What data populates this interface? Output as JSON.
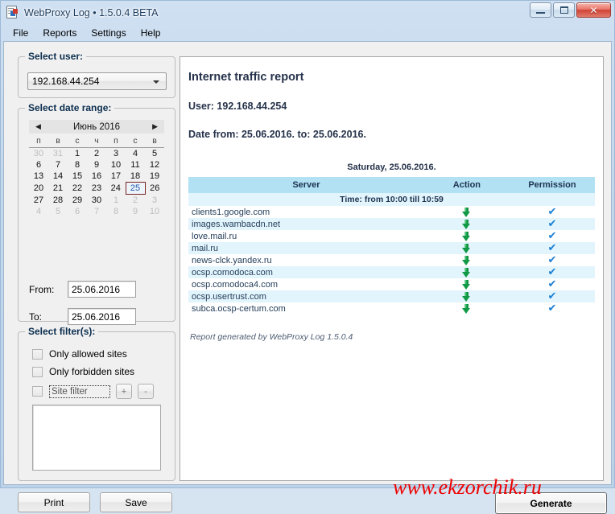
{
  "window": {
    "title": "WebProxy Log • 1.5.0.4 BETA",
    "icon": "report-document-icon",
    "controls": {
      "minimize": "−",
      "maximize": "□",
      "close": "✕"
    }
  },
  "menubar": {
    "items": [
      {
        "label": "File"
      },
      {
        "label": "Reports"
      },
      {
        "label": "Settings"
      },
      {
        "label": "Help"
      }
    ]
  },
  "user_group": {
    "title": "Select user:",
    "selected_user": "192.168.44.254"
  },
  "date_group": {
    "title": "Select date range:",
    "calendar": {
      "prev": "◀",
      "next": "▶",
      "month_title": "Июнь 2016",
      "weekdays": [
        "п",
        "в",
        "с",
        "ч",
        "п",
        "с",
        "в"
      ],
      "weeks": [
        [
          {
            "d": "30",
            "dim": true
          },
          {
            "d": "31",
            "dim": true
          },
          {
            "d": "1"
          },
          {
            "d": "2"
          },
          {
            "d": "3"
          },
          {
            "d": "4"
          },
          {
            "d": "5"
          }
        ],
        [
          {
            "d": "6"
          },
          {
            "d": "7"
          },
          {
            "d": "8"
          },
          {
            "d": "9"
          },
          {
            "d": "10"
          },
          {
            "d": "11"
          },
          {
            "d": "12"
          }
        ],
        [
          {
            "d": "13"
          },
          {
            "d": "14"
          },
          {
            "d": "15"
          },
          {
            "d": "16"
          },
          {
            "d": "17"
          },
          {
            "d": "18"
          },
          {
            "d": "19"
          }
        ],
        [
          {
            "d": "20"
          },
          {
            "d": "21"
          },
          {
            "d": "22"
          },
          {
            "d": "23"
          },
          {
            "d": "24"
          },
          {
            "d": "25",
            "selected": true
          },
          {
            "d": "26"
          }
        ],
        [
          {
            "d": "27"
          },
          {
            "d": "28"
          },
          {
            "d": "29"
          },
          {
            "d": "30"
          },
          {
            "d": "1",
            "dim": true
          },
          {
            "d": "2",
            "dim": true
          },
          {
            "d": "3",
            "dim": true
          }
        ],
        [
          {
            "d": "4",
            "dim": true
          },
          {
            "d": "5",
            "dim": true
          },
          {
            "d": "6",
            "dim": true
          },
          {
            "d": "7",
            "dim": true
          },
          {
            "d": "8",
            "dim": true
          },
          {
            "d": "9",
            "dim": true
          },
          {
            "d": "10",
            "dim": true
          }
        ]
      ]
    },
    "from_label": "From:",
    "from_value": "25.06.2016",
    "to_label": "To:",
    "to_value": "25.06.2016"
  },
  "filter_group": {
    "title": "Select filter(s):",
    "only_allowed_label": "Only allowed sites",
    "only_allowed_checked": false,
    "only_forbidden_label": "Only forbidden sites",
    "only_forbidden_checked": false,
    "site_filter_checked": false,
    "site_filter_placeholder": "Site filter",
    "site_filter_value": "",
    "add_button": "+",
    "remove_button": "-",
    "list_items": []
  },
  "report": {
    "title": "Internet traffic report",
    "user_line": "User: 192.168.44.254",
    "date_line": "Date from: 25.06.2016. to: 25.06.2016.",
    "day_title": "Saturday, 25.06.2016.",
    "columns": [
      "Server",
      "Action",
      "Permission"
    ],
    "time_row": "Time: from 10:00 till 10:59",
    "rows": [
      {
        "server": "clients1.google.com",
        "action": "download-arrow-icon",
        "permission": "allowed-check-icon"
      },
      {
        "server": "images.wambacdn.net",
        "action": "download-arrow-icon",
        "permission": "allowed-check-icon"
      },
      {
        "server": "love.mail.ru",
        "action": "download-arrow-icon",
        "permission": "allowed-check-icon"
      },
      {
        "server": "mail.ru",
        "action": "download-arrow-icon",
        "permission": "allowed-check-icon"
      },
      {
        "server": "news-clck.yandex.ru",
        "action": "download-arrow-icon",
        "permission": "allowed-check-icon"
      },
      {
        "server": "ocsp.comodoca.com",
        "action": "download-arrow-icon",
        "permission": "allowed-check-icon"
      },
      {
        "server": "ocsp.comodoca4.com",
        "action": "download-arrow-icon",
        "permission": "allowed-check-icon"
      },
      {
        "server": "ocsp.usertrust.com",
        "action": "download-arrow-icon",
        "permission": "allowed-check-icon"
      },
      {
        "server": "subca.ocsp-certum.com",
        "action": "download-arrow-icon",
        "permission": "allowed-check-icon"
      }
    ],
    "footer": "Report generated by WebProxy Log 1.5.0.4"
  },
  "watermark": "www.ekzorchik.ru",
  "buttons": {
    "print": "Print",
    "save": "Save",
    "generate": "Generate"
  },
  "colors": {
    "accent_blue": "#b2e1f4",
    "row_stripe": "#e2f4fc",
    "heading_text": "#25324a",
    "action_arrow_green": "#119a46",
    "permission_check_blue": "#1a7fd4",
    "watermark_red": "#ee0000",
    "selected_day": "#2059a8"
  }
}
